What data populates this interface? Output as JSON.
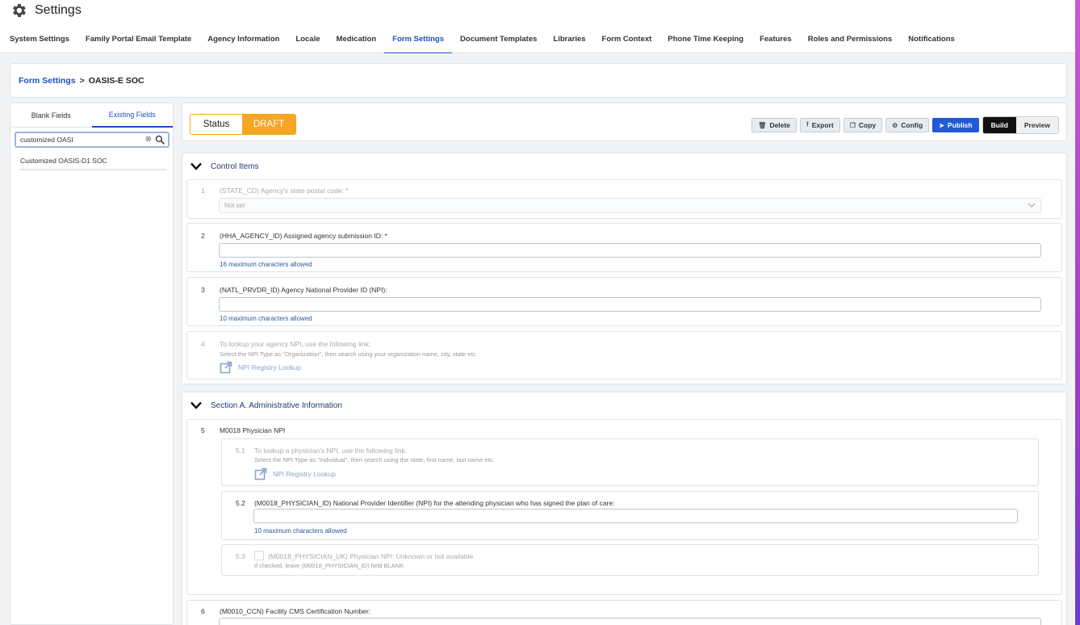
{
  "app": {
    "title": "Settings"
  },
  "nav": {
    "tabs": [
      {
        "label": "System Settings"
      },
      {
        "label": "Family Portal Email Template"
      },
      {
        "label": "Agency Information"
      },
      {
        "label": "Locale"
      },
      {
        "label": "Medication"
      },
      {
        "label": "Form Settings"
      },
      {
        "label": "Document Templates"
      },
      {
        "label": "Libraries"
      },
      {
        "label": "Form Context"
      },
      {
        "label": "Phone Time Keeping"
      },
      {
        "label": "Features"
      },
      {
        "label": "Roles and Permissions"
      },
      {
        "label": "Notifications"
      }
    ],
    "active": "Form Settings"
  },
  "breadcrumb": {
    "parent": "Form Settings",
    "separator": ">",
    "current": "OASIS-E SOC"
  },
  "sidebar": {
    "tabs": [
      {
        "label": "Blank Fields"
      },
      {
        "label": "Existing Fields"
      }
    ],
    "active_tab": "Existing Fields",
    "search": {
      "value": "customized OASI"
    },
    "results": [
      {
        "label": "Customized OASIS-D1 SOC"
      }
    ]
  },
  "toolbar": {
    "status_label": "Status",
    "status_value": "DRAFT",
    "delete": "Delete",
    "export": "Export",
    "copy": "Copy",
    "config": "Config",
    "publish": "Publish",
    "build": "Build",
    "preview": "Preview"
  },
  "colors": {
    "accent": "#1f4fbf",
    "draft": "#f5a623",
    "publish": "#1f5bd6"
  },
  "sections": {
    "control": {
      "title": "Control Items",
      "items": [
        {
          "num": "1",
          "label": "(STATE_CD) Agency's state postal code: *",
          "value": "Not set"
        },
        {
          "num": "2",
          "label": "(HHA_AGENCY_ID) Assigned agency submission ID: *",
          "hint": "16 maximum characters allowed"
        },
        {
          "num": "3",
          "label": "(NATL_PRVDR_ID) Agency National Provider ID (NPI):",
          "hint": "10 maximum characters allowed"
        },
        {
          "num": "4",
          "label": "To lookup your agency NPI, use the following link:",
          "sub": "Select the NPI Type as \"Organization\", then search using your organization name, city, state etc.",
          "link": "NPI Registry Lookup"
        }
      ]
    },
    "admin": {
      "title": "Section A. Administrative Information",
      "item5": {
        "num": "5",
        "label": "M0018 Physician NPI",
        "subs": [
          {
            "num": "5.1",
            "label": "To lookup a physician's NPI, use the following link:",
            "sub": "Select the NPI Type as \"Individual\", then search using the state, first name, last name etc.",
            "link": "NPI Registry Lookup"
          },
          {
            "num": "5.2",
            "label": "(M0018_PHYSICIAN_ID) National Provider Identifier (NPI) for the attending physician who has signed the plan of care:",
            "hint": "10 maximum characters allowed"
          },
          {
            "num": "5.3",
            "label": "(M0018_PHYSICIAN_UK) Physician NPI: Unknown or not available",
            "sub": "If checked, leave (M0018_PHYSICIAN_ID) field BLANK"
          }
        ]
      },
      "item6": {
        "num": "6",
        "label": "(M0010_CCN) Facility CMS Certification Number:"
      }
    }
  }
}
